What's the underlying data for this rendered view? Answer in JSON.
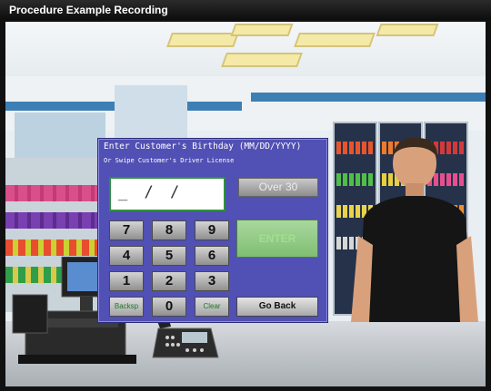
{
  "window": {
    "title": "Procedure Example Recording"
  },
  "prompt": {
    "heading": "Enter Customer's Birthday (MM/DD/YYYY)",
    "subheading": "Or Swipe Customer's Driver License"
  },
  "display": {
    "value": "_ / /"
  },
  "buttons": {
    "over30": "Over 30",
    "enter": "ENTER",
    "go_back": "Go Back"
  },
  "keypad": {
    "k7": "7",
    "k8": "8",
    "k9": "9",
    "k4": "4",
    "k5": "5",
    "k6": "6",
    "k1": "1",
    "k2": "2",
    "k3": "3",
    "backspace": "Backsp",
    "k0": "0",
    "clear": "Clear"
  },
  "colors": {
    "panel": "#5150b4",
    "enter": "#8fca83",
    "display_border": "#2f8f3f"
  },
  "icons": [
    "cash-register-icon",
    "desk-phone-icon"
  ]
}
